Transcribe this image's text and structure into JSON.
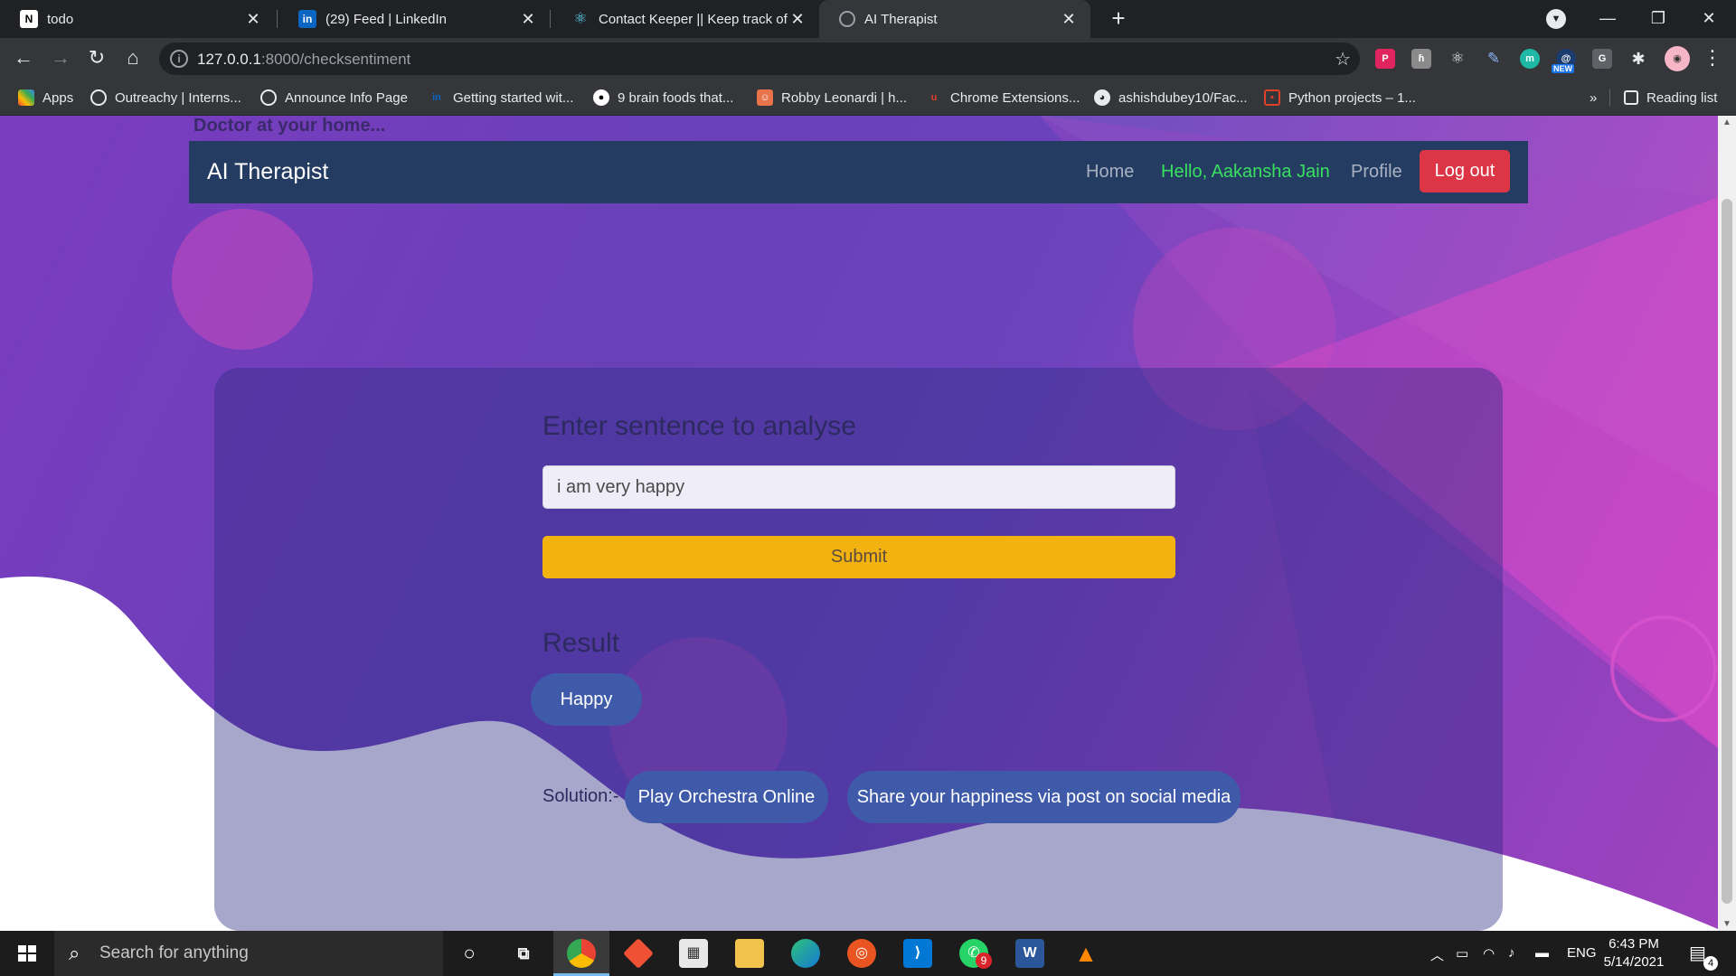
{
  "browser": {
    "tabs": [
      {
        "title": "todo",
        "favicon": "notion-icon"
      },
      {
        "title": "(29) Feed | LinkedIn",
        "favicon": "linkedin-icon"
      },
      {
        "title": "Contact Keeper || Keep track of your contacts",
        "favicon": "react-icon"
      },
      {
        "title": "AI Therapist",
        "favicon": "globe-icon"
      }
    ],
    "url": {
      "host": "127.0.0.1",
      "path": ":8000/checksentiment"
    },
    "bookmarks": [
      "Apps",
      "Outreachy | Interns...",
      "Announce Info Page",
      "Getting started wit...",
      "9 brain foods that...",
      "Robby Leonardi | h...",
      "Chrome Extensions...",
      "ashishdubey10/Fac...",
      "Python projects – 1..."
    ],
    "bookmarks_overflow": "»",
    "reading_list": "Reading list",
    "ext_new_badge": "NEW"
  },
  "page": {
    "tagline": "Doctor at your home...",
    "brand": "AI Therapist",
    "nav": {
      "home": "Home",
      "hello": "Hello, Aakansha Jain",
      "profile": "Profile",
      "logout": "Log out"
    },
    "form": {
      "heading": "Enter sentence to analyse",
      "input_value": "i am very happy",
      "submit_label": "Submit"
    },
    "result": {
      "heading": "Result",
      "sentiment": "Happy"
    },
    "solution": {
      "label": "Solution:-",
      "items": [
        "Play Orchestra Online",
        "Share your happiness via post on social media"
      ]
    },
    "colors": {
      "navbar": "#243b62",
      "logout": "#dc3545",
      "submit": "#f2b310",
      "greeting": "#39e060",
      "pill": "#3f5aa8"
    }
  },
  "taskbar": {
    "search_placeholder": "Search for anything",
    "language": "ENG",
    "time": "6:43 PM",
    "date": "5/14/2021",
    "notification_count": "4",
    "whatsapp_badge": "9"
  }
}
